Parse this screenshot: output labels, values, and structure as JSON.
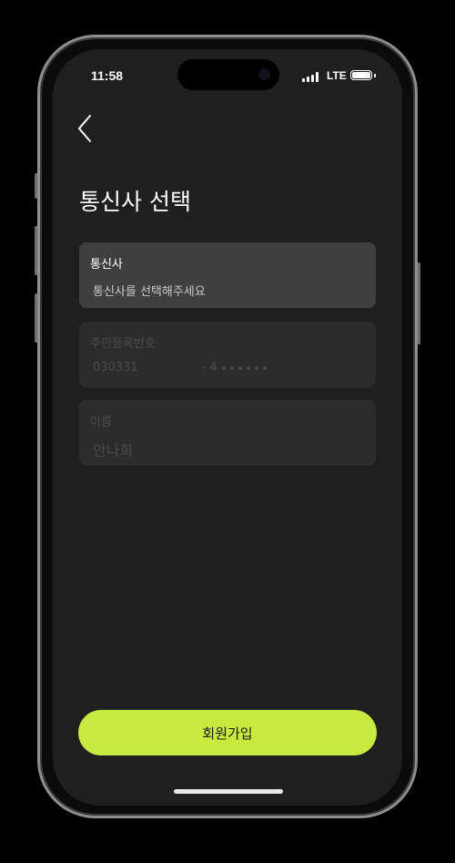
{
  "status_bar": {
    "time": "11:58",
    "network": "LTE"
  },
  "header": {
    "back_icon": "chevron-left-icon",
    "title": "통신사 선택"
  },
  "form": {
    "carrier": {
      "label": "통신사",
      "placeholder": "통신사를 선택해주세요"
    },
    "rrn": {
      "label": "주민등록번호",
      "front": "030331",
      "back_first_digit": "4"
    },
    "name": {
      "label": "이름",
      "value": "안나희"
    }
  },
  "submit": {
    "label": "회원가입",
    "color": "#c6ea3e"
  },
  "colors": {
    "background": "#1f1f1f",
    "field_active": "#3f3f3f",
    "field_inactive": "#2c2c2c"
  }
}
